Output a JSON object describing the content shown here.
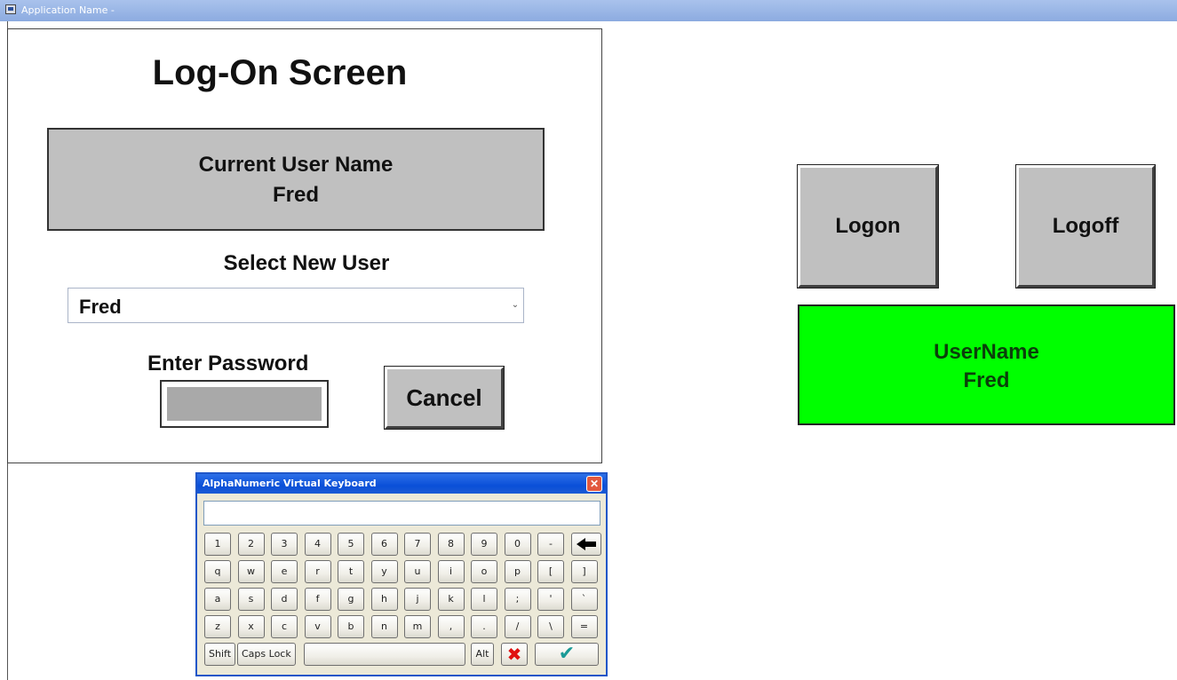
{
  "window": {
    "title": "Application Name -"
  },
  "logon_panel": {
    "title": "Log-On Screen",
    "current_user_label": "Current User Name",
    "current_user_value": "Fred",
    "select_label": "Select New User",
    "selected_user": "Fred",
    "password_label": "Enter Password",
    "cancel_label": "Cancel"
  },
  "right_panel": {
    "logon_label": "Logon",
    "logoff_label": "Logoff",
    "username_label": "UserName",
    "username_value": "Fred",
    "status_color": "#00ff00"
  },
  "keyboard": {
    "title": "AlphaNumeric Virtual Keyboard",
    "rows": [
      [
        "1",
        "2",
        "3",
        "4",
        "5",
        "6",
        "7",
        "8",
        "9",
        "0",
        "-"
      ],
      [
        "q",
        "w",
        "e",
        "r",
        "t",
        "y",
        "u",
        "i",
        "o",
        "p",
        "[",
        "]"
      ],
      [
        "a",
        "s",
        "d",
        "f",
        "g",
        "h",
        "j",
        "k",
        "l",
        ";",
        "'",
        "`"
      ],
      [
        "z",
        "x",
        "c",
        "v",
        "b",
        "n",
        "m",
        ",",
        ".",
        "/",
        "\\",
        "="
      ]
    ],
    "shift_label": "Shift",
    "caps_label": "Caps Lock",
    "alt_label": "Alt",
    "backspace_icon": "backspace-arrow-icon",
    "cancel_icon": "red-x-icon",
    "ok_icon": "checkmark-icon"
  }
}
